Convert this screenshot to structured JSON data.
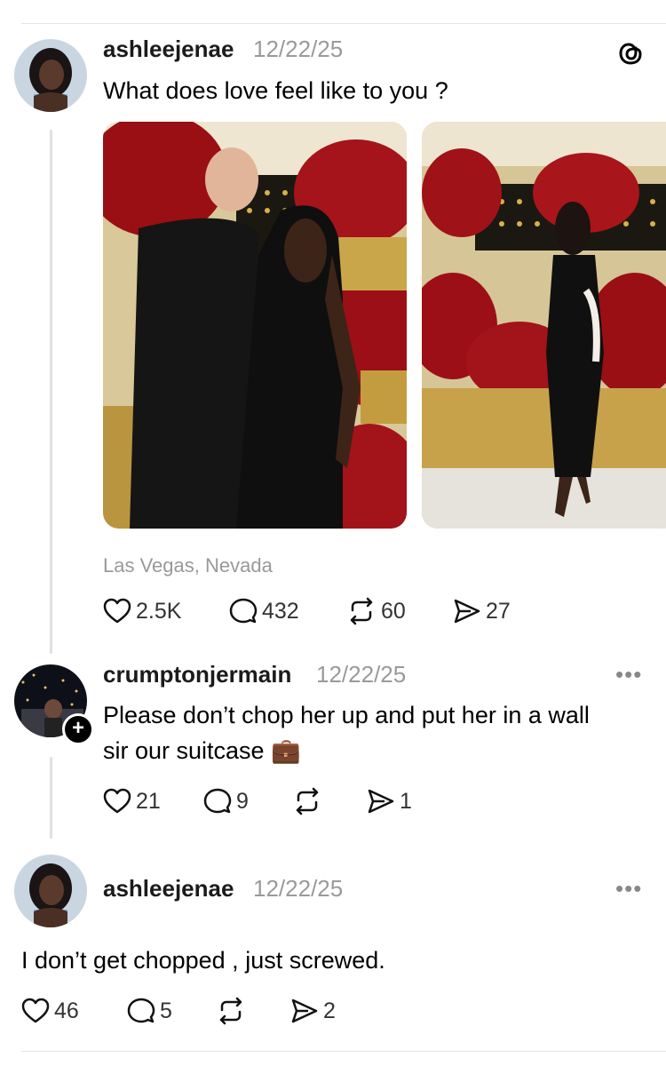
{
  "post1": {
    "username": "ashleejenae",
    "date": "12/22/25",
    "text": "What does love feel like to you ?",
    "location": "Las Vegas, Nevada",
    "likes": "2.5K",
    "replies": "432",
    "reposts": "60",
    "shares": "27"
  },
  "post2": {
    "username": "crumptonjermain",
    "date": "12/22/25",
    "text_line1": "Please don’t chop her up and put her in a wall",
    "text_line2": "sir our suitcase 💼",
    "likes": "21",
    "replies": "9",
    "shares": "1",
    "more": "•••"
  },
  "post3": {
    "username": "ashleejenae",
    "date": "12/22/25",
    "text": "I don’t get chopped , just screwed.",
    "likes": "46",
    "replies": "5",
    "shares": "2",
    "more": "•••"
  },
  "icons": {
    "like": "heart-icon",
    "reply": "comment-icon",
    "repost": "repost-icon",
    "share": "send-icon",
    "brand": "threads-logo-icon"
  }
}
